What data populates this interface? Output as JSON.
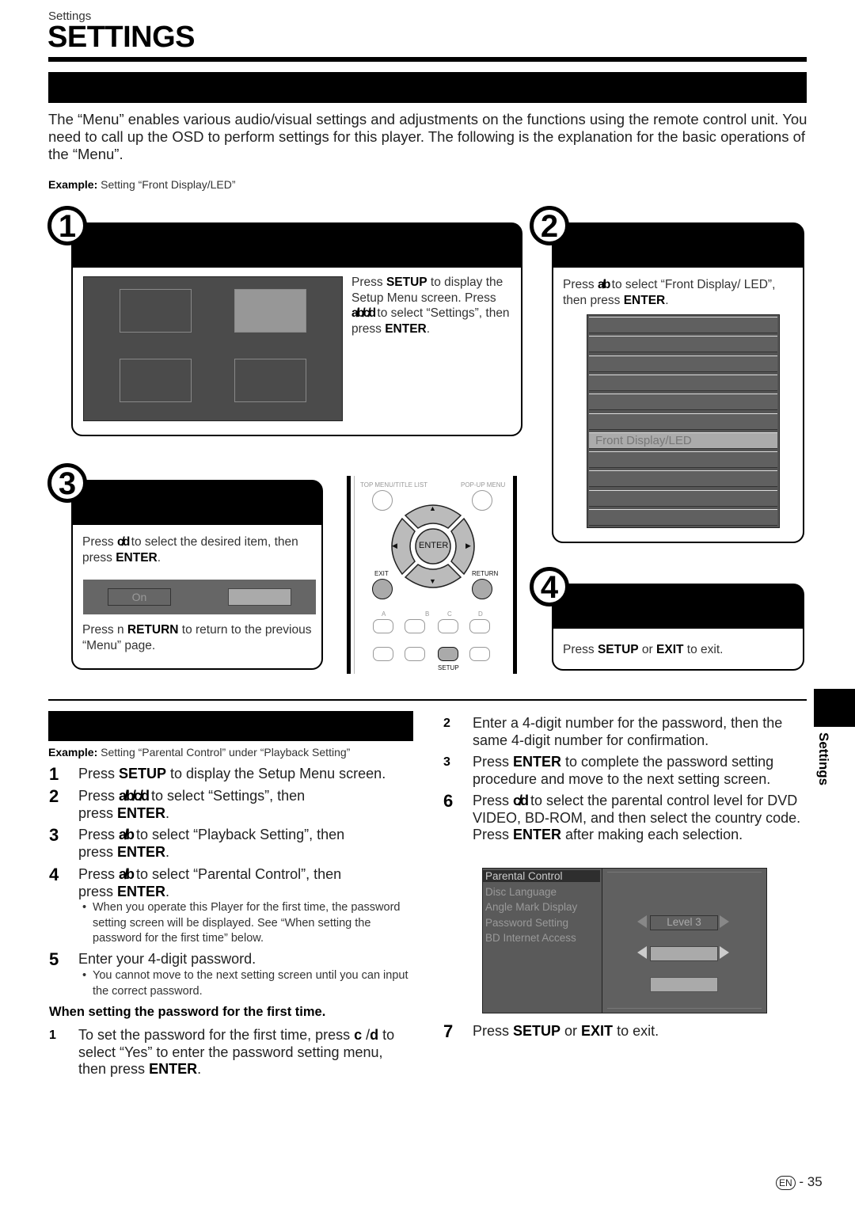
{
  "header": {
    "breadcrumb": "Settings",
    "title": "SETTINGS"
  },
  "intro": {
    "text": "The “Menu” enables various audio/visual settings and adjustments on the functions using the remote control unit. You need to call up the OSD to perform settings for this player. The following is the explanation for the basic operations of the “Menu”.",
    "example_label": "Example:",
    "example_text": " Setting “Front Display/LED”"
  },
  "step1": {
    "badge": "1",
    "t1": "Press ",
    "b1": "SETUP",
    "t2": " to display the Setup Menu screen. Press ",
    "arrows": "a/b/c/d",
    "t3": " to select “Settings”, then press ",
    "b2": "ENTER",
    "t4": "."
  },
  "step2": {
    "badge": "2",
    "t1": "Press ",
    "arrows": "a/b",
    "t2": " to select “Front Display/ LED”, then press ",
    "b1": "ENTER",
    "t3": ".",
    "menu_items": [
      "",
      "",
      "",
      "",
      "",
      "",
      "Front Display/LED",
      "",
      "",
      "",
      ""
    ],
    "selected_index": 6
  },
  "step3": {
    "badge": "3",
    "t1": "Press ",
    "arrows": "c/d",
    "t2": " to select the desired item, then press ",
    "b1": "ENTER",
    "t3": ".",
    "option_on": "On",
    "option_off": "",
    "r1": "Press ",
    "r_icon": "n",
    "r_b": " RETURN",
    "r2": " to return to the previous “Menu” page."
  },
  "step4": {
    "badge": "4",
    "t1": "Press ",
    "b1": "SETUP",
    "t2": " or ",
    "b2": "EXIT",
    "t3": " to exit."
  },
  "remote": {
    "top_menu": "TOP MENU/TITLE LIST",
    "popup_menu": "POP-UP MENU",
    "enter": "ENTER",
    "exit": "EXIT",
    "return": "RETURN",
    "a": "A",
    "b": "B",
    "c": "C",
    "d": "D",
    "setup": "SETUP",
    "up": "▲",
    "down": "▼",
    "left": "◀",
    "right": "▶"
  },
  "side_tab": {
    "label": "Settings"
  },
  "parental": {
    "example_label": "Example:",
    "example_text": " Setting “Parental Control” under “Playback Setting”",
    "steps": [
      {
        "num": "1",
        "t1": "Press ",
        "b1": "SETUP",
        "t2": " to display the Setup Menu screen."
      },
      {
        "num": "2",
        "t1": "Press ",
        "arrows": "a/b/c/d",
        "t2": " to select “Settings”, then press ",
        "b1": "ENTER",
        "t3": "."
      },
      {
        "num": "3",
        "t1": "Press ",
        "arrows": "a/b",
        "t2": " to select “Playback Setting”, then press ",
        "b1": "ENTER",
        "t3": "."
      },
      {
        "num": "4",
        "t1": "Press ",
        "arrows": "a/b",
        "t2": " to select “Parental Control”, then press ",
        "b1": "ENTER",
        "t3": "."
      },
      {
        "num": "5",
        "t1": "Enter your 4-digit password."
      }
    ],
    "bullet4": "When you operate this Player for the first time, the password setting screen will be displayed. See “When setting the password for the first time” below.",
    "bullet5": "You cannot move to the next setting screen until you can input the correct password.",
    "subhead": "When setting the password for the first time.",
    "first_steps": [
      {
        "num": "1",
        "t1": "To set the password for the first time, press ",
        "b1": "c",
        "t2": " /",
        "b2": "d",
        "t3": " to select “Yes” to enter the password setting menu, then press ",
        "b3": "ENTER",
        "t4": "."
      },
      {
        "num": "2",
        "t1": "Enter a 4-digit number for the password, then the same 4-digit number for confirmation."
      },
      {
        "num": "3",
        "t1": "Press ",
        "b1": "ENTER",
        "t2": " to complete the password setting procedure and move to the next setting screen."
      }
    ],
    "step6": {
      "num": "6",
      "t1": "Press ",
      "arrows": "c/d",
      "t2": " to select the parental control level for DVD VIDEO, BD-ROM, and then select the country code. Press ",
      "b1": "ENTER",
      "t3": " after making each selection."
    },
    "step7": {
      "num": "7",
      "t1": "Press ",
      "b1": "SETUP",
      "t2": " or ",
      "b2": "EXIT",
      "t3": " to exit."
    },
    "osd_menu": [
      "Parental Control",
      "Disc Language",
      "Angle Mark Display",
      "Password Setting",
      "BD Internet Access"
    ],
    "osd_selected": 0,
    "level_value": "Level 3"
  },
  "footer": {
    "lang": "EN",
    "page": "- 35"
  }
}
